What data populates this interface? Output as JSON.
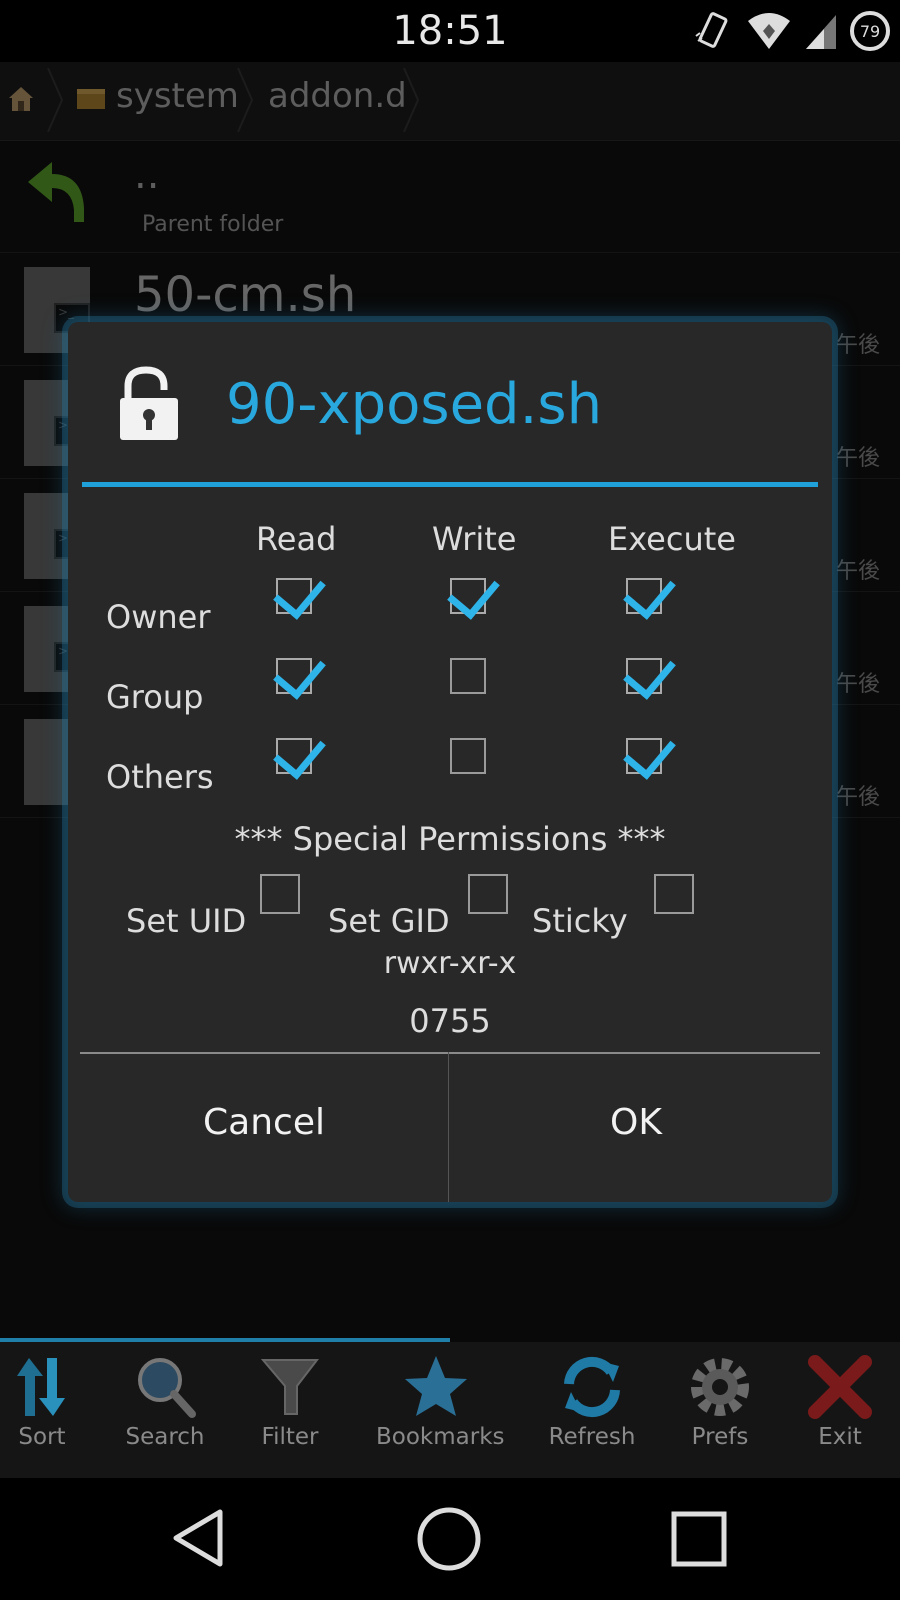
{
  "status_bar": {
    "time": "18:51",
    "battery": "79"
  },
  "breadcrumb": {
    "items": [
      "system",
      "addon.d"
    ]
  },
  "file_list": {
    "parent_dots": "..",
    "parent_label": "Parent folder",
    "files": [
      {
        "name": "50-cm.sh",
        "time": "午後"
      },
      {
        "name": "",
        "time": "午後"
      },
      {
        "name": "",
        "time": "午後"
      },
      {
        "name": "",
        "time": "午後"
      },
      {
        "name": "",
        "time": "午後"
      }
    ]
  },
  "dialog": {
    "title": "90-xposed.sh",
    "columns": [
      "Read",
      "Write",
      "Execute"
    ],
    "rows": [
      {
        "label": "Owner",
        "checks": [
          true,
          true,
          true
        ]
      },
      {
        "label": "Group",
        "checks": [
          true,
          false,
          true
        ]
      },
      {
        "label": "Others",
        "checks": [
          true,
          false,
          true
        ]
      }
    ],
    "special_title": "*** Special Permissions ***",
    "special": [
      {
        "label": "Set UID",
        "checked": false
      },
      {
        "label": "Set GID",
        "checked": false
      },
      {
        "label": "Sticky",
        "checked": false
      }
    ],
    "permission_string": "rwxr-xr-x",
    "octal": "0755",
    "cancel_label": "Cancel",
    "ok_label": "OK"
  },
  "toolbar": {
    "items": [
      {
        "label": "Sort",
        "icon": "sort-icon"
      },
      {
        "label": "Search",
        "icon": "search-icon"
      },
      {
        "label": "Filter",
        "icon": "filter-icon"
      },
      {
        "label": "Bookmarks",
        "icon": "star-icon"
      },
      {
        "label": "Refresh",
        "icon": "refresh-icon"
      },
      {
        "label": "Prefs",
        "icon": "gear-icon"
      },
      {
        "label": "Exit",
        "icon": "close-icon"
      }
    ]
  },
  "colors": {
    "accent": "#1fa0d8",
    "title": "#29a8de",
    "check": "#2fb4ea"
  }
}
